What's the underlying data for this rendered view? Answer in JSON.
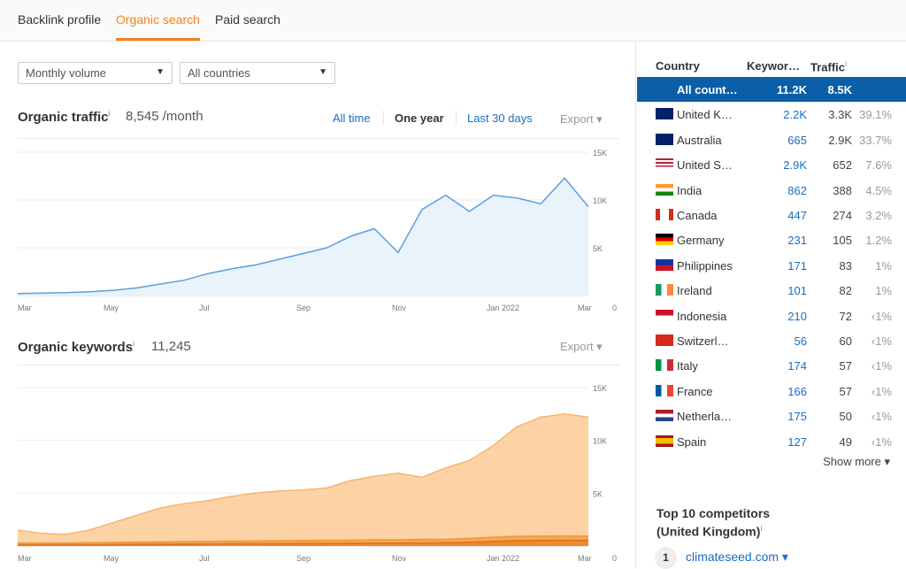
{
  "nav": {
    "tabs": [
      {
        "label": "Backlink profile"
      },
      {
        "label": "Organic search",
        "active": true
      },
      {
        "label": "Paid search"
      }
    ]
  },
  "filters": {
    "volume": "Monthly volume",
    "country": "All countries"
  },
  "traffic": {
    "title": "Organic traffic",
    "info": "i",
    "value": "8,545 /month",
    "ranges": [
      "All time",
      "One year",
      "Last 30 days"
    ],
    "active_range": "One year",
    "export": "Export ▾"
  },
  "keywords": {
    "title": "Organic keywords",
    "info": "i",
    "value": "11,245",
    "export": "Export ▾"
  },
  "colors": {
    "accent": "#f5811f",
    "link": "#1a6ec4",
    "selected": "#0b5ea8",
    "traffic_line": "#5b9fe0",
    "keywords_fill": "#fdd3a5"
  },
  "chart_data": [
    {
      "type": "area",
      "x_ticks": [
        "Mar",
        "May",
        "Jul",
        "Sep",
        "Nov",
        "Jan 2022",
        "Mar"
      ],
      "y_ticks": [
        "0",
        "5K",
        "10K",
        "15K"
      ],
      "ylim": [
        0,
        15000
      ],
      "grid": true,
      "x": [
        "2021-03",
        "2021-03b",
        "2021-04",
        "2021-04b",
        "2021-05",
        "2021-05b",
        "2021-06",
        "2021-06b",
        "2021-07",
        "2021-07b",
        "2021-08",
        "2021-08b",
        "2021-09",
        "2021-09b",
        "2021-10",
        "2021-10b",
        "2021-11",
        "2021-11b",
        "2021-12",
        "2021-12b",
        "2022-01",
        "2022-01b",
        "2022-02",
        "2022-02b",
        "2022-03"
      ],
      "series": [
        {
          "values": [
            200,
            250,
            300,
            400,
            550,
            800,
            1200,
            1600,
            2300,
            2800,
            3200,
            3800,
            4400,
            5000,
            6200,
            7000,
            4500,
            9000,
            10500,
            8800,
            10500,
            10200,
            9600,
            12300,
            9300
          ]
        }
      ]
    },
    {
      "type": "area",
      "x_ticks": [
        "Mar",
        "May",
        "Jul",
        "Sep",
        "Nov",
        "Jan 2022",
        "Mar"
      ],
      "y_ticks": [
        "0",
        "5K",
        "10K",
        "15K"
      ],
      "ylim": [
        0,
        15000
      ],
      "grid": true,
      "series": [
        {
          "values": [
            1500,
            1200,
            1100,
            1500,
            2200,
            2900,
            3600,
            4000,
            4300,
            4700,
            5000,
            5200,
            5300,
            5500,
            6200,
            6600,
            6900,
            6500,
            7400,
            8100,
            9500,
            11300,
            12200,
            12500,
            12200
          ]
        },
        {
          "values": [
            250,
            260,
            270,
            290,
            320,
            350,
            380,
            400,
            420,
            440,
            460,
            480,
            500,
            520,
            540,
            560,
            580,
            600,
            620,
            700,
            820,
            900,
            920,
            930,
            920
          ]
        },
        {
          "values": [
            80,
            90,
            100,
            110,
            120,
            140,
            160,
            170,
            180,
            190,
            200,
            210,
            220,
            230,
            240,
            250,
            260,
            280,
            300,
            340,
            420,
            500,
            520,
            530,
            520
          ]
        }
      ]
    }
  ],
  "countries": {
    "headers": [
      "Country",
      "Keywor…",
      "Traffic"
    ],
    "traffic_info": "i",
    "rows": [
      {
        "name": "All count…",
        "kw": "11.2K",
        "tr": "8.5K",
        "pc": "",
        "flag": "none"
      },
      {
        "name": "United K…",
        "kw": "2.2K",
        "tr": "3.3K",
        "pc": "39.1%",
        "flag": "gb"
      },
      {
        "name": "Australia",
        "kw": "665",
        "tr": "2.9K",
        "pc": "33.7%",
        "flag": "au"
      },
      {
        "name": "United S…",
        "kw": "2.9K",
        "tr": "652",
        "pc": "7.6%",
        "flag": "us"
      },
      {
        "name": "India",
        "kw": "862",
        "tr": "388",
        "pc": "4.5%",
        "flag": "in"
      },
      {
        "name": "Canada",
        "kw": "447",
        "tr": "274",
        "pc": "3.2%",
        "flag": "ca"
      },
      {
        "name": "Germany",
        "kw": "231",
        "tr": "105",
        "pc": "1.2%",
        "flag": "de"
      },
      {
        "name": "Philippines",
        "kw": "171",
        "tr": "83",
        "pc": "1%",
        "flag": "ph"
      },
      {
        "name": "Ireland",
        "kw": "101",
        "tr": "82",
        "pc": "1%",
        "flag": "ie"
      },
      {
        "name": "Indonesia",
        "kw": "210",
        "tr": "72",
        "pc": "‹1%",
        "flag": "id"
      },
      {
        "name": "Switzerl…",
        "kw": "56",
        "tr": "60",
        "pc": "‹1%",
        "flag": "ch"
      },
      {
        "name": "Italy",
        "kw": "174",
        "tr": "57",
        "pc": "‹1%",
        "flag": "it"
      },
      {
        "name": "France",
        "kw": "166",
        "tr": "57",
        "pc": "‹1%",
        "flag": "fr"
      },
      {
        "name": "Netherla…",
        "kw": "175",
        "tr": "50",
        "pc": "‹1%",
        "flag": "nl"
      },
      {
        "name": "Spain",
        "kw": "127",
        "tr": "49",
        "pc": "‹1%",
        "flag": "es"
      }
    ],
    "show_more": "Show more ▾"
  },
  "competitors": {
    "title": "Top 10 competitors",
    "subtitle": "(United Kingdom)",
    "info": "i",
    "items": [
      {
        "rank": "1",
        "domain": "climateseed.com ▾"
      }
    ]
  }
}
